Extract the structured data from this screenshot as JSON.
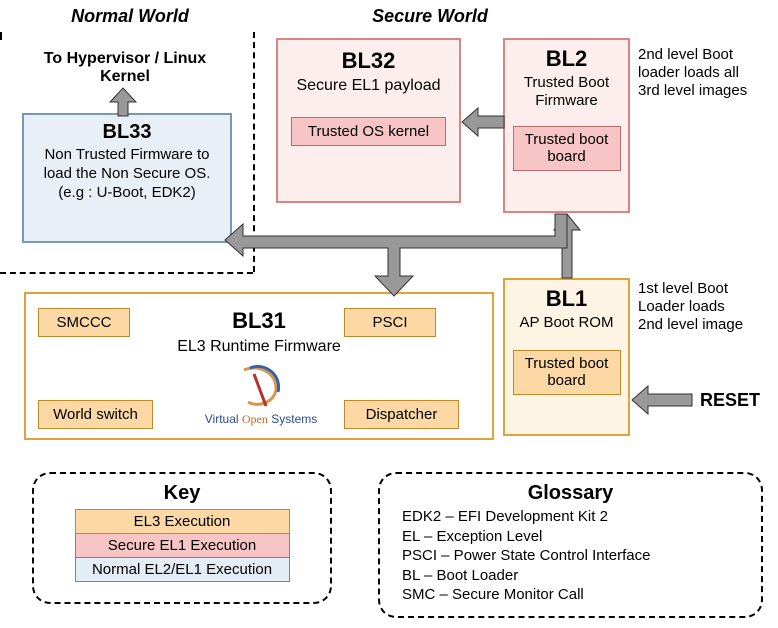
{
  "worlds": {
    "normal": "Normal World",
    "secure": "Secure World"
  },
  "top_label": "To Hypervisor / Linux Kernel",
  "bl33": {
    "title": "BL33",
    "desc": "Non Trusted Firmware to load the Non Secure OS. (e.g : U-Boot, EDK2)"
  },
  "bl32": {
    "title": "BL32",
    "desc": "Secure EL1 payload",
    "sub": "Trusted OS kernel"
  },
  "bl2": {
    "title": "BL2",
    "desc": "Trusted Boot Firmware",
    "sub": "Trusted boot board",
    "side": "2nd level Boot loader loads all 3rd level images"
  },
  "bl31": {
    "title": "BL31",
    "desc": "EL3 Runtime Firmware",
    "logo": "Virtual Open Systems",
    "tags": {
      "smccc": "SMCCC",
      "psci": "PSCI",
      "world_switch": "World switch",
      "dispatcher": "Dispatcher"
    }
  },
  "bl1": {
    "title": "BL1",
    "desc": "AP Boot ROM",
    "sub": "Trusted boot board",
    "side": "1st level Boot Loader loads 2nd level image"
  },
  "reset": "RESET",
  "key": {
    "title": "Key",
    "el3": "EL3 Execution",
    "sel1": "Secure EL1 Execution",
    "nel": "Normal EL2/EL1 Execution"
  },
  "glossary": {
    "title": "Glossary",
    "lines": [
      "EDK2 – EFI Development Kit 2",
      "EL – Exception Level",
      "PSCI – Power State Control Interface",
      "BL – Boot Loader",
      "SMC – Secure Monitor Call"
    ]
  }
}
